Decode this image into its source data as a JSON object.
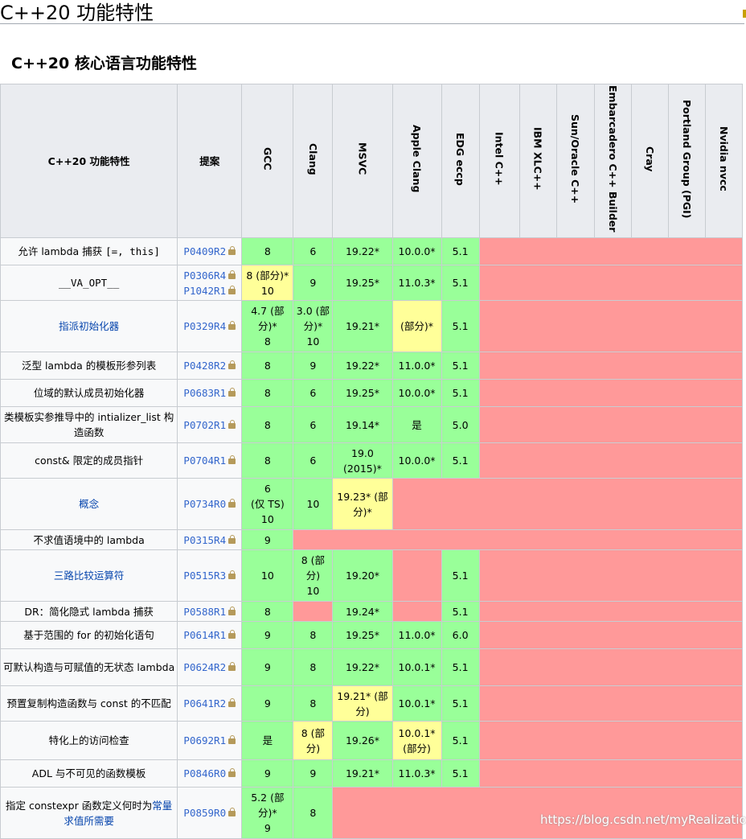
{
  "page": {
    "title": "C++20 功能特性",
    "section_title": "C++20 核心语言功能特性",
    "watermark": "https://blog.csdn.net/myRealization"
  },
  "table": {
    "header_feature": "C++20 功能特性",
    "header_paper": "提案",
    "compilers": [
      "GCC",
      "Clang",
      "MSVC",
      "Apple Clang",
      "EDG eccp",
      "Intel C++",
      "IBM XLC++",
      "Sun/Oracle C++",
      "Embarcadero C++ Builder",
      "Cray",
      "Portland Group (PGI)",
      "Nvidia nvcc"
    ],
    "status_colors": {
      "supported": "#99ff99",
      "partial": "#ffff99",
      "unsupported": "#ff9999"
    },
    "rows": [
      {
        "feature": [
          {
            "t": "允许 lambda 捕获 "
          },
          {
            "t": "[=, this]",
            "c": 1
          }
        ],
        "papers": [
          "P0409R2"
        ],
        "cells": [
          {
            "s": "y",
            "v": [
              "8"
            ]
          },
          {
            "s": "y",
            "v": [
              "6"
            ]
          },
          {
            "s": "y",
            "v": [
              "19.22*"
            ]
          },
          {
            "s": "y",
            "v": [
              "10.0.0*"
            ]
          },
          {
            "s": "y",
            "v": [
              "5.1"
            ]
          },
          {
            "s": "n",
            "v": [
              ""
            ],
            "span": 7
          }
        ]
      },
      {
        "feature": [
          {
            "t": "__VA_OPT__",
            "c": 1
          }
        ],
        "papers": [
          "P0306R4",
          "P1042R1"
        ],
        "cells": [
          {
            "s": "p",
            "v": [
              "8 (部分)*",
              "10"
            ]
          },
          {
            "s": "y",
            "v": [
              "9"
            ]
          },
          {
            "s": "y",
            "v": [
              "19.25*"
            ]
          },
          {
            "s": "y",
            "v": [
              "11.0.3*"
            ]
          },
          {
            "s": "y",
            "v": [
              "5.1"
            ]
          },
          {
            "s": "n",
            "v": [
              ""
            ],
            "span": 7
          }
        ]
      },
      {
        "feature": [
          {
            "t": "指派初始化器",
            "l": 1
          }
        ],
        "papers": [
          "P0329R4"
        ],
        "cells": [
          {
            "s": "y",
            "v": [
              "4.7 (部",
              "分)*",
              "8"
            ]
          },
          {
            "s": "y",
            "v": [
              "3.0 (部",
              "分)*",
              "10"
            ]
          },
          {
            "s": "y",
            "v": [
              "19.21*"
            ]
          },
          {
            "s": "p",
            "v": [
              "(部分)*"
            ]
          },
          {
            "s": "y",
            "v": [
              "5.1"
            ]
          },
          {
            "s": "n",
            "v": [
              ""
            ],
            "span": 7
          }
        ]
      },
      {
        "feature": [
          {
            "t": "泛型 lambda 的模板形参列表"
          }
        ],
        "papers": [
          "P0428R2"
        ],
        "cells": [
          {
            "s": "y",
            "v": [
              "8"
            ]
          },
          {
            "s": "y",
            "v": [
              "9"
            ]
          },
          {
            "s": "y",
            "v": [
              "19.22*"
            ]
          },
          {
            "s": "y",
            "v": [
              "11.0.0*"
            ]
          },
          {
            "s": "y",
            "v": [
              "5.1"
            ]
          },
          {
            "s": "n",
            "v": [
              ""
            ],
            "span": 7
          }
        ]
      },
      {
        "feature": [
          {
            "t": "位域的默认成员初始化器"
          }
        ],
        "papers": [
          "P0683R1"
        ],
        "cells": [
          {
            "s": "y",
            "v": [
              "8"
            ]
          },
          {
            "s": "y",
            "v": [
              "6"
            ]
          },
          {
            "s": "y",
            "v": [
              "19.25*"
            ]
          },
          {
            "s": "y",
            "v": [
              "10.0.0*"
            ]
          },
          {
            "s": "y",
            "v": [
              "5.1"
            ]
          },
          {
            "s": "n",
            "v": [
              ""
            ],
            "span": 7
          }
        ]
      },
      {
        "feature": [
          {
            "t": "类模板实参推导中的 intializer_list 构造函数"
          }
        ],
        "papers": [
          "P0702R1"
        ],
        "cells": [
          {
            "s": "y",
            "v": [
              "8"
            ]
          },
          {
            "s": "y",
            "v": [
              "6"
            ]
          },
          {
            "s": "y",
            "v": [
              "19.14*"
            ]
          },
          {
            "s": "y",
            "v": [
              "是"
            ]
          },
          {
            "s": "y",
            "v": [
              "5.0"
            ]
          },
          {
            "s": "n",
            "v": [
              ""
            ],
            "span": 7
          }
        ]
      },
      {
        "feature": [
          {
            "t": "const& 限定的成员指针"
          }
        ],
        "papers": [
          "P0704R1"
        ],
        "cells": [
          {
            "s": "y",
            "v": [
              "8"
            ]
          },
          {
            "s": "y",
            "v": [
              "6"
            ]
          },
          {
            "s": "y",
            "v": [
              "19.0",
              "(2015)*"
            ]
          },
          {
            "s": "y",
            "v": [
              "10.0.0*"
            ]
          },
          {
            "s": "y",
            "v": [
              "5.1"
            ]
          },
          {
            "s": "n",
            "v": [
              ""
            ],
            "span": 7
          }
        ]
      },
      {
        "feature": [
          {
            "t": "概念",
            "l": 1
          }
        ],
        "papers": [
          "P0734R0"
        ],
        "cells": [
          {
            "s": "y",
            "v": [
              "6",
              "(仅 TS)",
              "10"
            ]
          },
          {
            "s": "y",
            "v": [
              "10"
            ]
          },
          {
            "s": "p",
            "v": [
              "19.23* (部",
              "分)*"
            ]
          },
          {
            "s": "n",
            "v": [
              ""
            ],
            "span": 9
          }
        ]
      },
      {
        "feature": [
          {
            "t": "不求值语境中的 lambda"
          }
        ],
        "papers": [
          "P0315R4"
        ],
        "cells": [
          {
            "s": "y",
            "v": [
              "9"
            ]
          },
          {
            "s": "n",
            "v": [
              ""
            ],
            "span": 11
          }
        ]
      },
      {
        "feature": [
          {
            "t": "三路比较运算符",
            "l": 1
          }
        ],
        "papers": [
          "P0515R3"
        ],
        "cells": [
          {
            "s": "y",
            "v": [
              "10"
            ]
          },
          {
            "s": "y",
            "v": [
              "8 (部",
              "分)",
              "10"
            ]
          },
          {
            "s": "y",
            "v": [
              "19.20*"
            ]
          },
          {
            "s": "n",
            "v": [
              ""
            ]
          },
          {
            "s": "y",
            "v": [
              "5.1"
            ]
          },
          {
            "s": "n",
            "v": [
              ""
            ],
            "span": 7
          }
        ]
      },
      {
        "feature": [
          {
            "t": "DR：简化隐式 lambda 捕获"
          }
        ],
        "papers": [
          "P0588R1"
        ],
        "cells": [
          {
            "s": "y",
            "v": [
              "8"
            ]
          },
          {
            "s": "n",
            "v": [
              ""
            ]
          },
          {
            "s": "y",
            "v": [
              "19.24*"
            ]
          },
          {
            "s": "n",
            "v": [
              ""
            ]
          },
          {
            "s": "y",
            "v": [
              "5.1"
            ]
          },
          {
            "s": "n",
            "v": [
              ""
            ],
            "span": 7
          }
        ]
      },
      {
        "feature": [
          {
            "t": "基于范围的 for 的初始化语句"
          }
        ],
        "papers": [
          "P0614R1"
        ],
        "cells": [
          {
            "s": "y",
            "v": [
              "9"
            ]
          },
          {
            "s": "y",
            "v": [
              "8"
            ]
          },
          {
            "s": "y",
            "v": [
              "19.25*"
            ]
          },
          {
            "s": "y",
            "v": [
              "11.0.0*"
            ]
          },
          {
            "s": "y",
            "v": [
              "6.0"
            ]
          },
          {
            "s": "n",
            "v": [
              ""
            ],
            "span": 7
          }
        ]
      },
      {
        "feature": [
          {
            "t": "可默认构造与可赋值的无状态 lambda"
          }
        ],
        "papers": [
          "P0624R2"
        ],
        "cells": [
          {
            "s": "y",
            "v": [
              "9"
            ]
          },
          {
            "s": "y",
            "v": [
              "8"
            ]
          },
          {
            "s": "y",
            "v": [
              "19.22*"
            ]
          },
          {
            "s": "y",
            "v": [
              "10.0.1*"
            ]
          },
          {
            "s": "y",
            "v": [
              "5.1"
            ]
          },
          {
            "s": "n",
            "v": [
              ""
            ],
            "span": 7
          }
        ]
      },
      {
        "feature": [
          {
            "t": "预置复制构造函数与 const 的不匹配"
          }
        ],
        "papers": [
          "P0641R2"
        ],
        "cells": [
          {
            "s": "y",
            "v": [
              "9"
            ]
          },
          {
            "s": "y",
            "v": [
              "8"
            ]
          },
          {
            "s": "p",
            "v": [
              "19.21* (部",
              "分)"
            ]
          },
          {
            "s": "y",
            "v": [
              "10.0.1*"
            ]
          },
          {
            "s": "y",
            "v": [
              "5.1"
            ]
          },
          {
            "s": "n",
            "v": [
              ""
            ],
            "span": 7
          }
        ]
      },
      {
        "feature": [
          {
            "t": "特化上的访问检查"
          }
        ],
        "papers": [
          "P0692R1"
        ],
        "cells": [
          {
            "s": "y",
            "v": [
              "是"
            ]
          },
          {
            "s": "p",
            "v": [
              "8 (部",
              "分)"
            ]
          },
          {
            "s": "y",
            "v": [
              "19.26*"
            ]
          },
          {
            "s": "p",
            "v": [
              "10.0.1*",
              "(部分)"
            ]
          },
          {
            "s": "y",
            "v": [
              "5.1"
            ]
          },
          {
            "s": "n",
            "v": [
              ""
            ],
            "span": 7
          }
        ]
      },
      {
        "feature": [
          {
            "t": "ADL 与不可见的函数模板"
          }
        ],
        "papers": [
          "P0846R0"
        ],
        "cells": [
          {
            "s": "y",
            "v": [
              "9"
            ]
          },
          {
            "s": "y",
            "v": [
              "9"
            ]
          },
          {
            "s": "y",
            "v": [
              "19.21*"
            ]
          },
          {
            "s": "y",
            "v": [
              "11.0.3*"
            ]
          },
          {
            "s": "y",
            "v": [
              "5.1"
            ]
          },
          {
            "s": "n",
            "v": [
              ""
            ],
            "span": 7
          }
        ]
      },
      {
        "feature": [
          {
            "t": "指定 constexpr 函数定义何时为"
          },
          {
            "t": "常量求值所需要",
            "l": 1
          }
        ],
        "papers": [
          "P0859R0"
        ],
        "cells": [
          {
            "s": "y",
            "v": [
              "5.2 (部",
              "分)*",
              "9"
            ]
          },
          {
            "s": "y",
            "v": [
              "8"
            ]
          },
          {
            "s": "n",
            "v": [
              ""
            ],
            "span": 10
          }
        ]
      }
    ]
  }
}
